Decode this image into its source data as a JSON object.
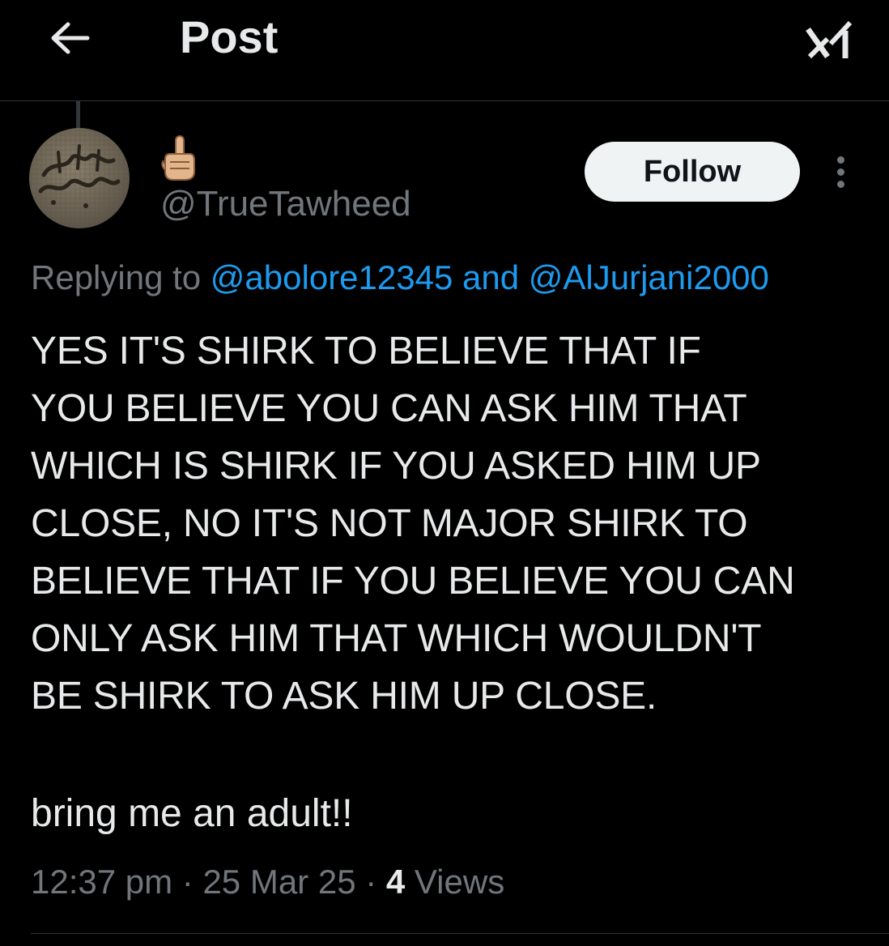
{
  "header": {
    "back_icon": "arrow-left-icon",
    "title": "Post",
    "grok_icon": "grok-icon"
  },
  "author": {
    "display_name_emoji": "☝🏼",
    "handle": "@TrueTawheed",
    "avatar_icon": "avatar-calligraphy-image"
  },
  "actions": {
    "follow_label": "Follow",
    "more_icon": "more-vertical-icon"
  },
  "reply": {
    "prefix": "Replying to ",
    "mention_1": "@abolore12345",
    "conjunction": " and ",
    "mention_2": "@AlJurjani2000"
  },
  "post": {
    "text_main": "YES IT'S SHIRK TO BELIEVE THAT IF\nYOU BELIEVE YOU CAN ASK HIM THAT\nWHICH IS SHIRK IF YOU ASKED HIM UP\nCLOSE, NO IT'S NOT MAJOR SHIRK TO\nBELIEVE THAT IF YOU BELIEVE YOU CAN\nONLY ASK HIM THAT WHICH WOULDN'T\nBE SHIRK TO ASK HIM UP CLOSE.",
    "text_secondary": "bring me an adult!!"
  },
  "meta": {
    "time": "12:37 pm",
    "separator_1": " · ",
    "date": "25 Mar 25",
    "separator_2": " · ",
    "views_count": "4",
    "views_label": " Views"
  },
  "colors": {
    "background": "#000000",
    "text": "#e7e9ea",
    "muted": "#71767b",
    "link": "#1d9bf0",
    "button_bg": "#eff3f4"
  }
}
